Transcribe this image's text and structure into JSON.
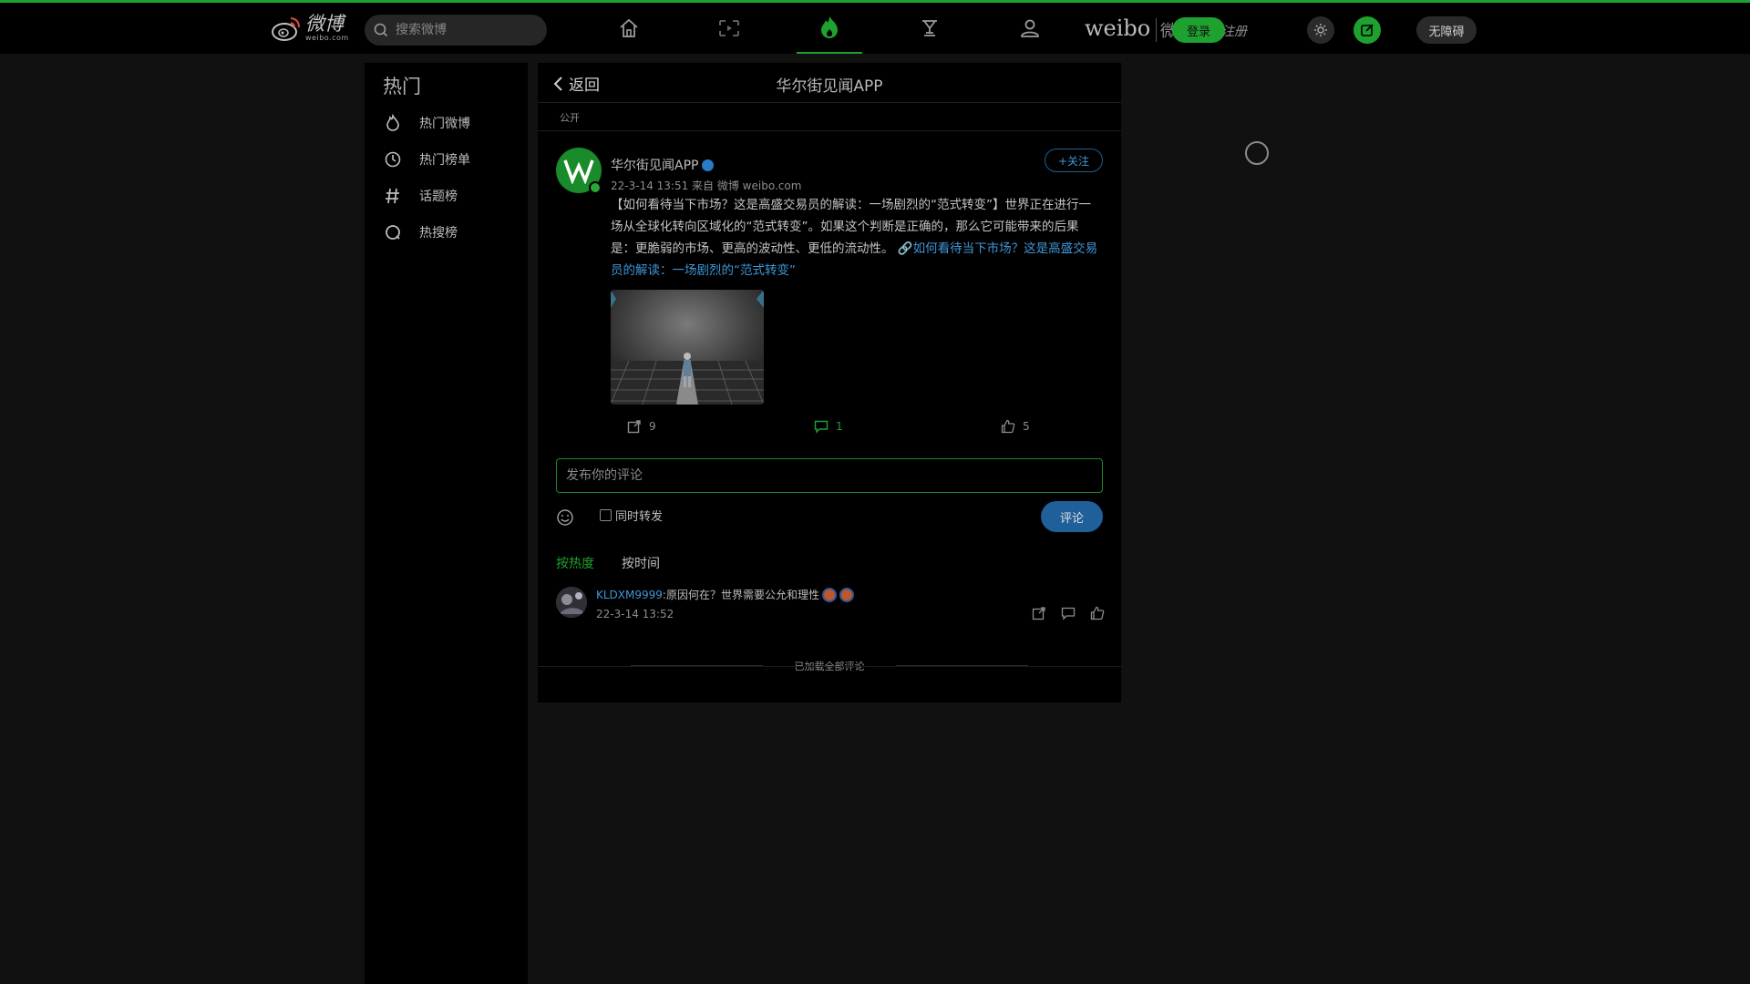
{
  "header": {
    "logo_zh": "微博",
    "logo_en": "weibo.com",
    "search_placeholder": "搜索微博",
    "nav": [
      "home-icon",
      "video-icon",
      "hot-icon",
      "trophy-icon",
      "user-icon"
    ],
    "brand": "weibo",
    "brand_zh": "微博",
    "login": "登录",
    "register": "注册",
    "access_button": "无障碍"
  },
  "sidebar": {
    "title": "热门",
    "items": [
      {
        "label": "热门微博",
        "icon": "fire-icon"
      },
      {
        "label": "热门榜单",
        "icon": "clock-icon"
      },
      {
        "label": "话题榜",
        "icon": "hashtag-icon"
      },
      {
        "label": "热搜榜",
        "icon": "search-icon"
      }
    ]
  },
  "post": {
    "back": "返回",
    "page_title": "华尔街见闻APP",
    "visibility": "公开",
    "author": "华尔街见闻APP",
    "meta": "22-3-14 13:51 来自 微博 weibo.com",
    "follow": "+关注",
    "text": "【如何看待当下市场？这是高盛交易员的解读：一场剧烈的“范式转变”】世界正在进行一场从全球化转向区域化的“范式转变”。如果这个判断是正确的，那么它可能带来的后果是：更脆弱的市场、更高的波动性、更低的流动性。",
    "link_text": "如何看待当下市场？这是高盛交易员的解读：一场剧烈的“范式转变”",
    "reposts": "9",
    "comments": "1",
    "likes": "5"
  },
  "composer": {
    "placeholder": "发布你的评论",
    "repost_label": "同时转发",
    "submit": "评论"
  },
  "comments": {
    "sort_hot": "按热度",
    "sort_time": "按时间",
    "list": [
      {
        "user": "KLDXM9999",
        "text": ":原因何在？世界需要公允和理性",
        "time": "22-3-14 13:52"
      }
    ],
    "end_text": "已加载全部评论"
  },
  "colors": {
    "accent": "#1fa12f",
    "link": "#3e96d8",
    "background": "#111111"
  }
}
